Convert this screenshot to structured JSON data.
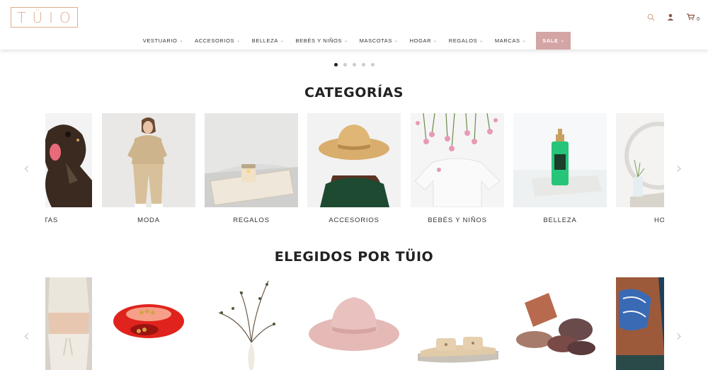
{
  "brand": {
    "logo_text": "TÜIO",
    "accent_color": "#e0ab8f"
  },
  "header": {
    "icons": [
      "search-icon",
      "user-icon",
      "cart-icon"
    ],
    "cart_count": "0"
  },
  "nav": {
    "items": [
      {
        "label": "VESTUARIO"
      },
      {
        "label": "ACCESORIOS"
      },
      {
        "label": "BELLEZA"
      },
      {
        "label": "BEBÉS Y NIÑOS"
      },
      {
        "label": "MASCOTAS"
      },
      {
        "label": "HOGAR"
      },
      {
        "label": "REGALOS"
      },
      {
        "label": "MARCAS"
      }
    ],
    "sale_label": "SALE",
    "sale_color": "#d4a5a5"
  },
  "slider": {
    "dots": 5,
    "active": 1
  },
  "categories": {
    "title": "CATEGORÍAS",
    "items": [
      {
        "label": "COTAS"
      },
      {
        "label": "MODA"
      },
      {
        "label": "REGALOS"
      },
      {
        "label": "ACCESORIOS"
      },
      {
        "label": "BEBÉS Y NIÑOS"
      },
      {
        "label": "BELLEZA"
      },
      {
        "label": "HOG"
      }
    ]
  },
  "featured": {
    "title": "ELEGIDOS POR TÜIO"
  }
}
